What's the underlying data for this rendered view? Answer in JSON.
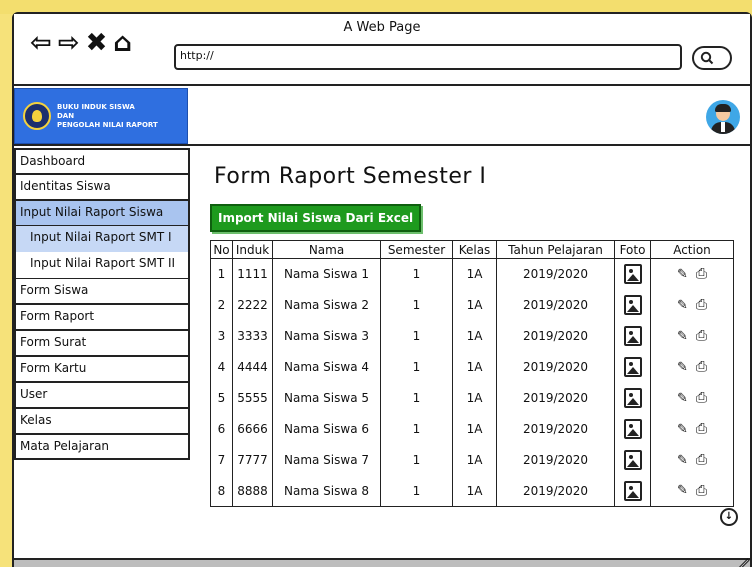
{
  "browser": {
    "title": "A Web Page",
    "url": "http://",
    "nav": {
      "back": "⇦",
      "forward": "⇨",
      "stop": "✖",
      "home": "⌂"
    },
    "search_icon": "search-icon"
  },
  "header": {
    "logo_line1": "BUKU INDUK SISWA",
    "logo_line2": "DAN",
    "logo_line3": "PENGOLAH NILAI RAPORT"
  },
  "sidebar": {
    "items": [
      {
        "label": "Dashboard"
      },
      {
        "label": "Identitas Siswa"
      },
      {
        "label": "Input Nilai Raport Siswa"
      },
      {
        "label": "Input Nilai Raport SMT I"
      },
      {
        "label": "Input Nilai Raport SMT II"
      },
      {
        "label": "Form Siswa"
      },
      {
        "label": "Form Raport"
      },
      {
        "label": "Form Surat"
      },
      {
        "label": "Form Kartu"
      },
      {
        "label": "User"
      },
      {
        "label": "Kelas"
      },
      {
        "label": "Mata Pelajaran"
      }
    ]
  },
  "main": {
    "title": "Form Raport Semester I",
    "import_button": "Import Nilai Siswa Dari Excel",
    "table": {
      "headers": [
        "No",
        "Induk",
        "Nama",
        "Semester",
        "Kelas",
        "Tahun Pelajaran",
        "Foto",
        "Action"
      ],
      "rows": [
        {
          "no": "1",
          "induk": "1111",
          "nama": "Nama Siswa 1",
          "semester": "1",
          "kelas": "1A",
          "tahun": "2019/2020"
        },
        {
          "no": "2",
          "induk": "2222",
          "nama": "Nama Siswa 2",
          "semester": "1",
          "kelas": "1A",
          "tahun": "2019/2020"
        },
        {
          "no": "3",
          "induk": "3333",
          "nama": "Nama Siswa 3",
          "semester": "1",
          "kelas": "1A",
          "tahun": "2019/2020"
        },
        {
          "no": "4",
          "induk": "4444",
          "nama": "Nama Siswa 4",
          "semester": "1",
          "kelas": "1A",
          "tahun": "2019/2020"
        },
        {
          "no": "5",
          "induk": "5555",
          "nama": "Nama Siswa 5",
          "semester": "1",
          "kelas": "1A",
          "tahun": "2019/2020"
        },
        {
          "no": "6",
          "induk": "6666",
          "nama": "Nama Siswa 6",
          "semester": "1",
          "kelas": "1A",
          "tahun": "2019/2020"
        },
        {
          "no": "7",
          "induk": "7777",
          "nama": "Nama Siswa 7",
          "semester": "1",
          "kelas": "1A",
          "tahun": "2019/2020"
        },
        {
          "no": "8",
          "induk": "8888",
          "nama": "Nama Siswa 8",
          "semester": "1",
          "kelas": "1A",
          "tahun": "2019/2020"
        }
      ]
    }
  },
  "colors": {
    "accent_blue": "#2f6fe0",
    "active_item": "#a9c4ef",
    "import_green": "#1e9a1e",
    "page_bg": "#f6e27a"
  }
}
